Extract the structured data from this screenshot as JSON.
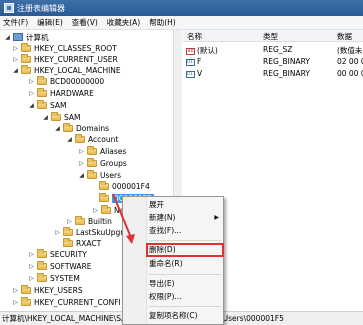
{
  "window": {
    "title": "注册表编辑器"
  },
  "menubar": {
    "items": [
      "文件(F)",
      "编辑(E)",
      "查看(V)",
      "收藏夹(A)",
      "帮助(H)"
    ]
  },
  "tree": {
    "computer": "计算机",
    "hkcr": "HKEY_CLASSES_ROOT",
    "hkcu": "HKEY_CURRENT_USER",
    "hklm": "HKEY_LOCAL_MACHINE",
    "bcd": "BCD00000000",
    "hardware": "HARDWARE",
    "sam": "SAM",
    "sam_inner": "SAM",
    "domains": "Domains",
    "account": "Account",
    "aliases": "Aliases",
    "groups": "Groups",
    "users": "Users",
    "user_1f4": "000001F4",
    "user_1f5": "000001F5",
    "names": "Nar",
    "builtin": "Builtin",
    "lastsku": "LastSkuUpgr",
    "rxact": "RXACT",
    "security": "SECURITY",
    "software": "SOFTWARE",
    "system": "SYSTEM",
    "hku": "HKEY_USERS",
    "hkcc": "HKEY_CURRENT_CONFI"
  },
  "values": {
    "headers": {
      "name": "名称",
      "type": "类型",
      "data": "数据"
    },
    "rows": [
      {
        "icon": "string-value-icon",
        "name": "(默认)",
        "type": "REG_SZ",
        "data": "(数值未"
      },
      {
        "icon": "binary-value-icon",
        "name": "F",
        "type": "REG_BINARY",
        "data": "02 00 0"
      },
      {
        "icon": "binary-value-icon",
        "name": "V",
        "type": "REG_BINARY",
        "data": "00 00 00"
      }
    ]
  },
  "context_menu": {
    "items": {
      "expand": "展开",
      "new": "新建(N)",
      "find": "查找(F)...",
      "delete": "删除(D)",
      "rename": "重命名(R)",
      "export": "导出(E)",
      "permissions": "权限(P)...",
      "copy_name": "复制项名称(C)"
    },
    "highlight_color": "#e03131"
  },
  "statusbar": {
    "path": "计算机\\HKEY_LOCAL_MACHINE\\SAM\\SAM\\Domains\\Account\\Users\\000001F5"
  },
  "colors": {
    "selection": "#3399ff",
    "titlebar": "#2a5a95",
    "annotation": "#e03131"
  }
}
